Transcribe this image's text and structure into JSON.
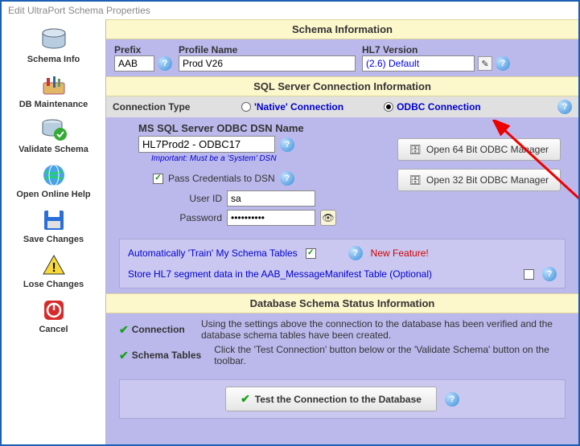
{
  "window": {
    "title": "Edit UltraPort Schema Properties"
  },
  "sidebar": {
    "items": [
      {
        "label": "Schema Info"
      },
      {
        "label": "DB Maintenance"
      },
      {
        "label": "Validate Schema"
      },
      {
        "label": "Open Online Help"
      },
      {
        "label": "Save Changes"
      },
      {
        "label": "Lose Changes"
      },
      {
        "label": "Cancel"
      }
    ]
  },
  "sections": {
    "schema_info": "Schema Information",
    "sql_conn": "SQL Server  Connection Information",
    "db_status": "Database Schema Status Information"
  },
  "fields": {
    "prefix_label": "Prefix",
    "prefix_value": "AAB",
    "profile_label": "Profile Name",
    "profile_value": "Prod V26",
    "hl7_label": "HL7 Version",
    "hl7_value": "(2.6) Default"
  },
  "conn": {
    "type_label": "Connection Type",
    "native": "'Native' Connection",
    "odbc": "ODBC Connection",
    "selected": "odbc"
  },
  "dsn": {
    "heading": "MS SQL Server ODBC DSN Name",
    "value": "HL7Prod2 - ODBC17",
    "note": "Important: Must be a 'System' DSN",
    "open64": "Open 64 Bit ODBC Manager",
    "open32": "Open 32 Bit ODBC Manager",
    "pass_creds_label": "Pass Credentials to DSN",
    "user_label": "User ID",
    "user_value": "sa",
    "pass_label": "Password",
    "pass_value": "••••••••••"
  },
  "options": {
    "train_label": "Automatically 'Train' My Schema Tables",
    "new_feature": "New Feature!",
    "store_label": "Store HL7 segment data in the AAB_MessageManifest Table (Optional)"
  },
  "status": {
    "conn_label": "Connection",
    "conn_text": "Using the settings above the connection to the database has been verified and the database schema tables have been created.",
    "schema_label": "Schema Tables",
    "schema_text": "Click the 'Test Connection' button below or the 'Validate Schema' button on the toolbar.",
    "test_btn": "Test the Connection to the Database"
  }
}
